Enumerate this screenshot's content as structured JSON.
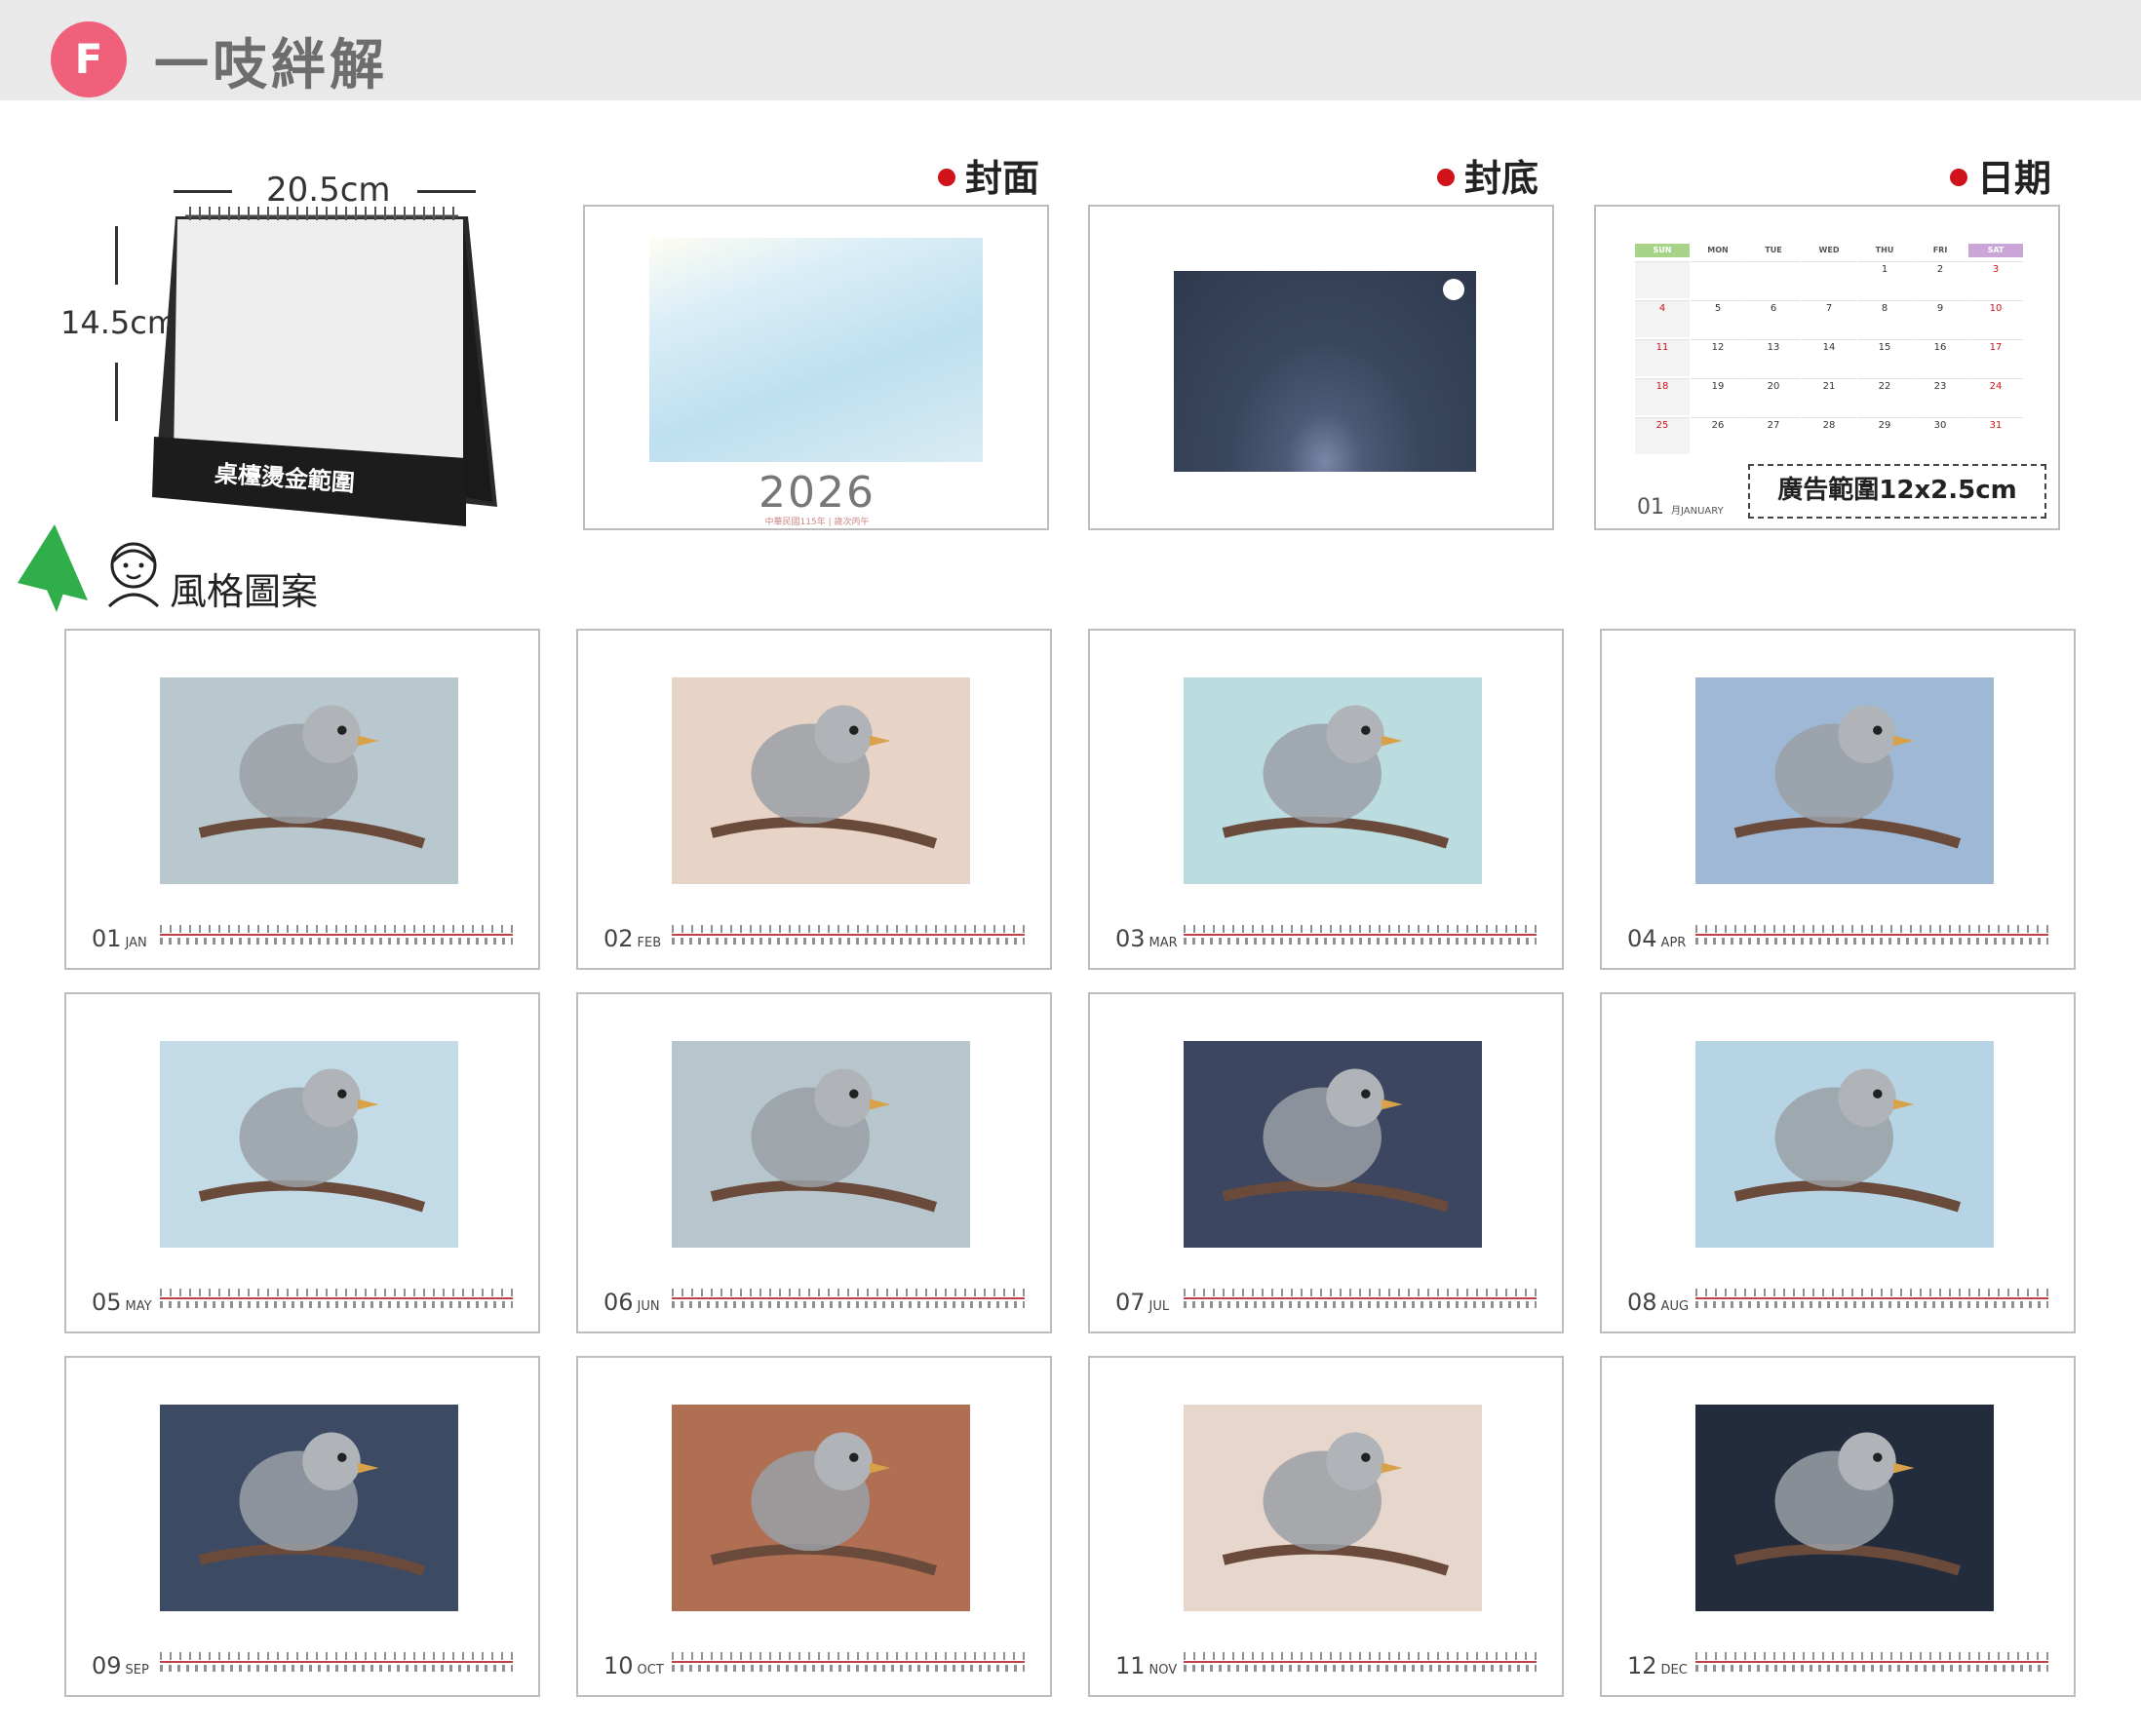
{
  "header": {
    "badge": "F",
    "title": "一吱絆解"
  },
  "desk": {
    "width_label": "20.5cm",
    "height_label": "14.5cm",
    "foil_label": "桌檯燙金範圍"
  },
  "sections": {
    "cover": "封面",
    "back": "封底",
    "dates": "日期"
  },
  "cover": {
    "year": "2026",
    "subtitle": "中華民國115年 | 歲次丙午"
  },
  "calendar": {
    "days": [
      "SUN",
      "MON",
      "TUE",
      "WED",
      "THU",
      "FRI",
      "SAT"
    ],
    "ad_area": "廣告範圍12x2.5cm",
    "month_num": "01",
    "month_small": "月",
    "month_name": "JANUARY",
    "weeks": [
      [
        "",
        "",
        "",
        "",
        "1",
        "2",
        "3"
      ],
      [
        "4",
        "5",
        "6",
        "7",
        "8",
        "9",
        "10"
      ],
      [
        "11",
        "12",
        "13",
        "14",
        "15",
        "16",
        "17"
      ],
      [
        "18",
        "19",
        "20",
        "21",
        "22",
        "23",
        "24"
      ],
      [
        "25",
        "26",
        "27",
        "28",
        "29",
        "30",
        "31"
      ]
    ]
  },
  "style_title": "風格圖案",
  "months": [
    {
      "num": "01",
      "abbr": "JAN",
      "color": "#b9c8cf"
    },
    {
      "num": "02",
      "abbr": "FEB",
      "color": "#e8d3c7"
    },
    {
      "num": "03",
      "abbr": "MAR",
      "color": "#bcdde0"
    },
    {
      "num": "04",
      "abbr": "APR",
      "color": "#9fb8d6"
    },
    {
      "num": "05",
      "abbr": "MAY",
      "color": "#c3dbe6"
    },
    {
      "num": "06",
      "abbr": "JUN",
      "color": "#b7c6cc"
    },
    {
      "num": "07",
      "abbr": "JUL",
      "color": "#3c4660"
    },
    {
      "num": "08",
      "abbr": "AUG",
      "color": "#b7d4e4"
    },
    {
      "num": "09",
      "abbr": "SEP",
      "color": "#3d4a63"
    },
    {
      "num": "10",
      "abbr": "OCT",
      "color": "#b06f52"
    },
    {
      "num": "11",
      "abbr": "NOV",
      "color": "#e7d6cc"
    },
    {
      "num": "12",
      "abbr": "DEC",
      "color": "#232c3d"
    }
  ],
  "colors": {
    "accent": "#f0607a",
    "red_dot": "#d0121b",
    "topbar": "#e9e9e9"
  }
}
